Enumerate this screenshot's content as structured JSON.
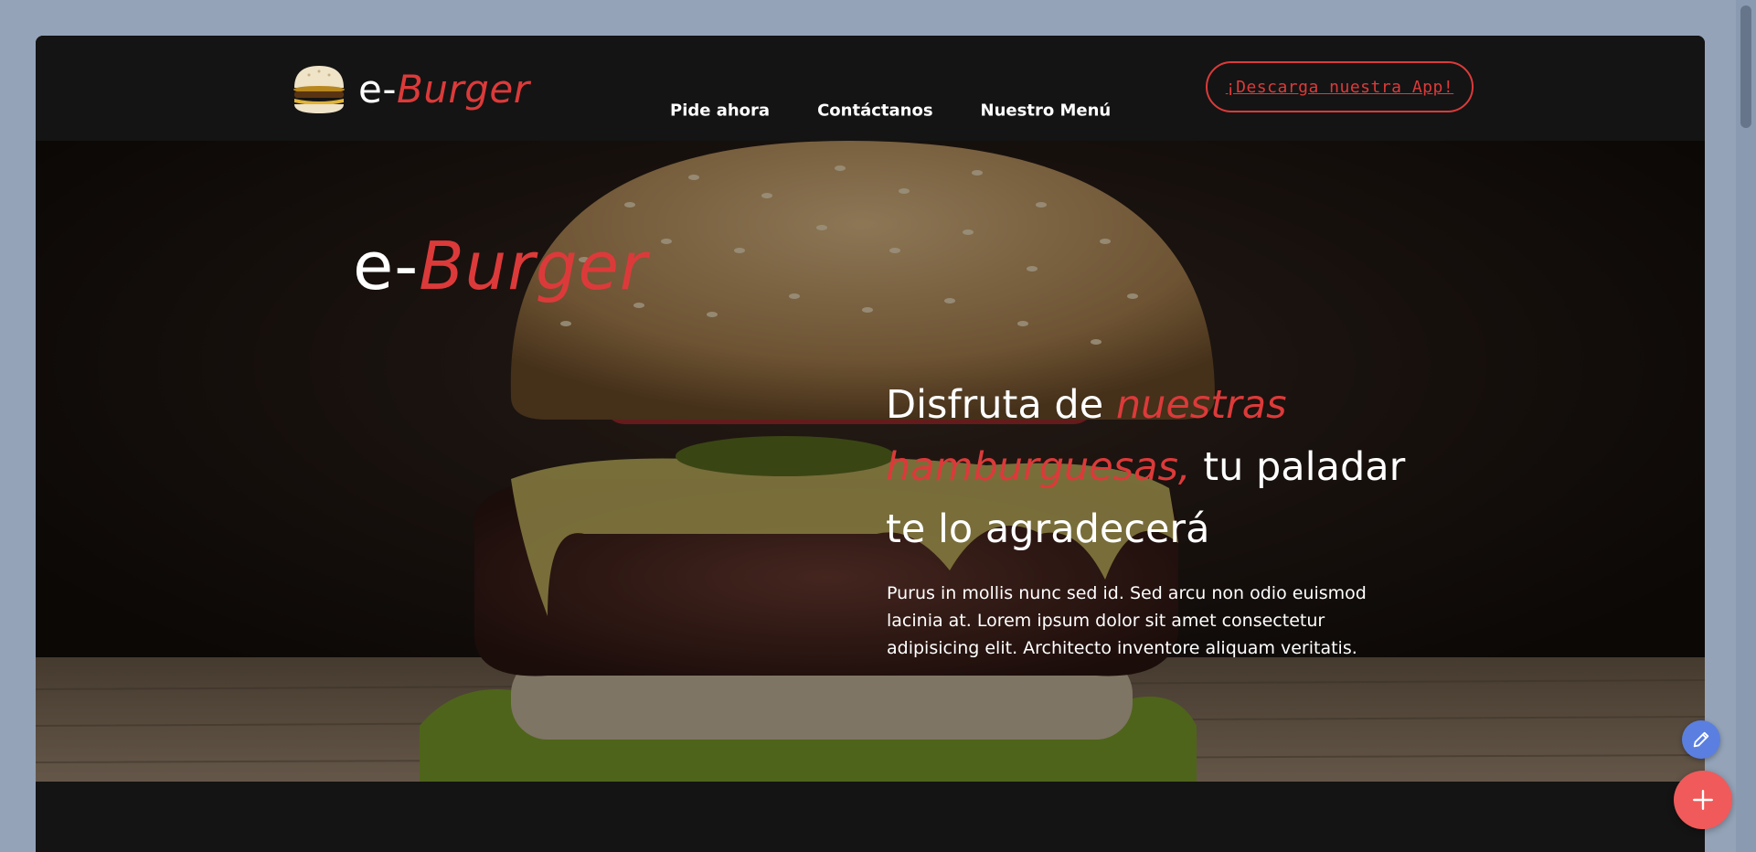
{
  "brand": {
    "prefix": "e-",
    "accent": "Burger",
    "icon": "burger-icon"
  },
  "nav": {
    "items": [
      {
        "label": "Pide ahora"
      },
      {
        "label": "Contáctanos"
      },
      {
        "label": "Nuestro Menú"
      }
    ]
  },
  "cta": {
    "label": "¡Descarga nuestra App!"
  },
  "hero": {
    "logo_prefix": "e-",
    "logo_accent": "Burger",
    "title_part1": "Disfruta de ",
    "title_accent": "nuestras hamburguesas,",
    "title_part2": " tu paladar te lo agradecerá",
    "text": "Purus in mollis nunc sed id. Sed arcu non odio euismod lacinia at. Lorem ipsum dolor sit amet consectetur adipisicing elit. Architecto inventore aliquam veritatis."
  },
  "floating": {
    "edit_icon": "pencil-icon",
    "add_icon": "plus-icon"
  },
  "colors": {
    "accent": "#dc3a3a",
    "dark": "#141414",
    "page_bg": "#94a3b8",
    "edit_fab": "#5b7fe0",
    "add_fab": "#f05a5a"
  }
}
